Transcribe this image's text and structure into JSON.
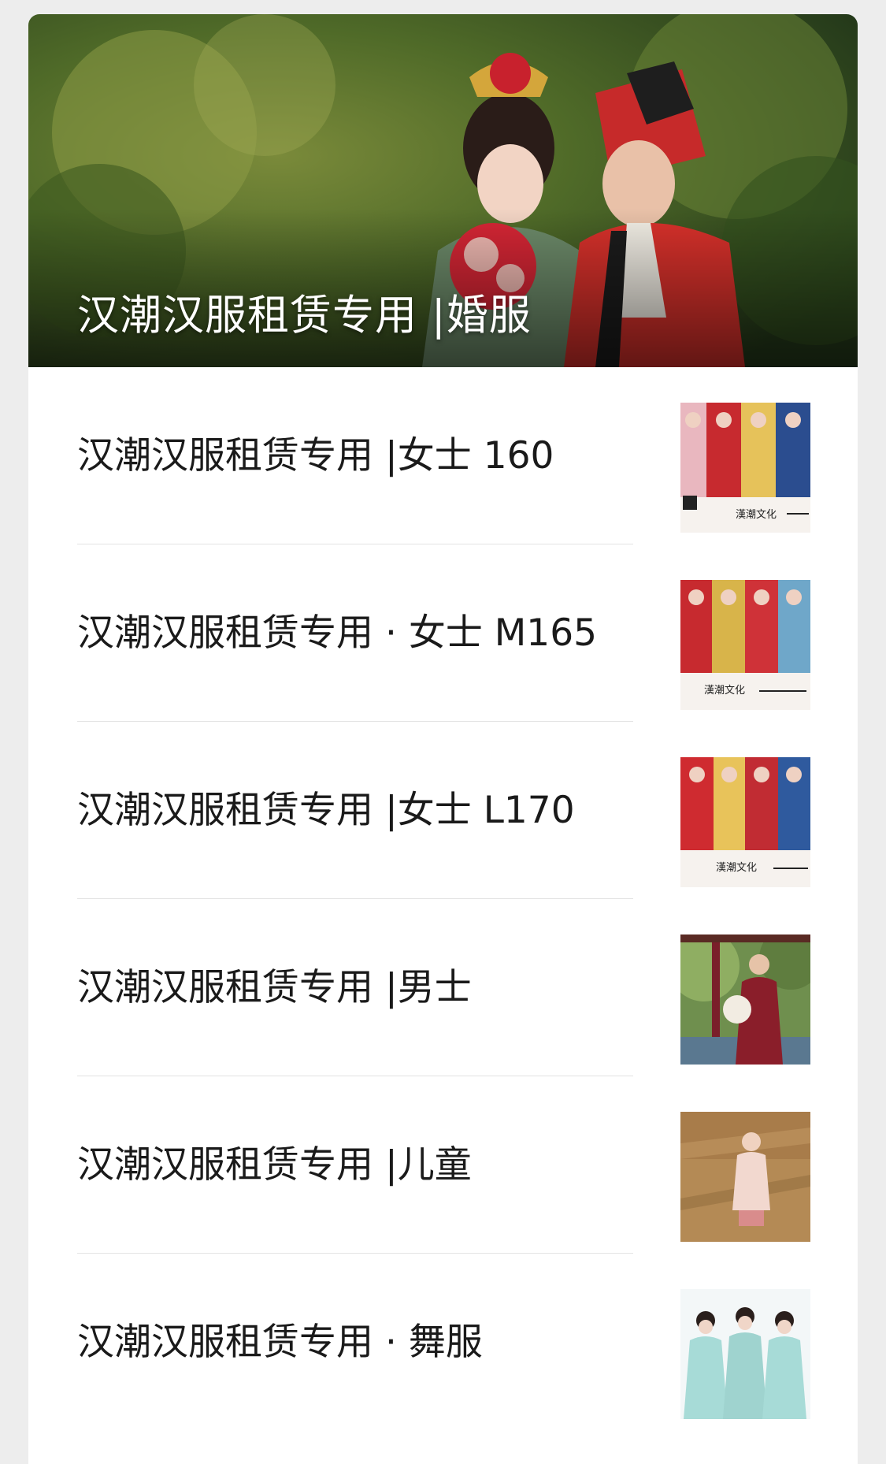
{
  "hero": {
    "title": "汉潮汉服租赁专用 |婚服",
    "image": "wedding-couple-photo"
  },
  "items": [
    {
      "title": "汉潮汉服租赁专用 |女士 160",
      "thumb": "group-women-poster-thumb"
    },
    {
      "title": "汉潮汉服租赁专用 · 女士 M165",
      "thumb": "group-women-poster-thumb"
    },
    {
      "title": "汉潮汉服租赁专用 |女士 L170",
      "thumb": "group-women-poster-thumb"
    },
    {
      "title": "汉潮汉服租赁专用 |男士",
      "thumb": "man-in-hanfu-thumb"
    },
    {
      "title": "汉潮汉服租赁专用 |儿童",
      "thumb": "child-in-hanfu-thumb"
    },
    {
      "title": "汉潮汉服租赁专用 · 舞服",
      "thumb": "dancers-thumb"
    }
  ],
  "poster_text": "漢潮文化"
}
